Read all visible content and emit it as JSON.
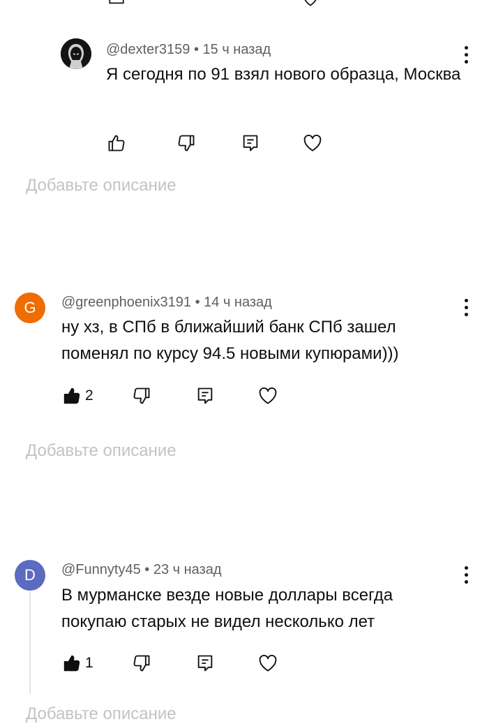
{
  "comments": [
    {
      "author": "@dexter3159",
      "time": "15 ч назад",
      "text": "Я сегодня по 91 взял нового образца, Москва",
      "likes": "",
      "liked": false,
      "avatar_letter": "",
      "avatar_color": "#1b1b1b"
    },
    {
      "author": "@greenphoenix3191",
      "time": "14 ч назад",
      "text": "ну хз, в СПб в ближайший банк СПб зашел поменял по курсу 94.5 новыми купюрами)))",
      "likes": "2",
      "liked": true,
      "avatar_letter": "G",
      "avatar_color": "#ef6c00"
    },
    {
      "author": "@Funnyty45",
      "time": "23 ч назад",
      "text": "В мурманске везде новые доллары всегда покупаю старых не видел несколько лет",
      "likes": "1",
      "liked": true,
      "avatar_letter": "D",
      "avatar_color": "#5c6bc0"
    }
  ],
  "separator": "•",
  "add_description_placeholder": "Добавьте описание",
  "colors": {
    "meta_text": "#606060",
    "placeholder": "#c3c3c3",
    "icon": "#0f0f0f"
  },
  "icons": [
    "like-icon",
    "dislike-icon",
    "reply-icon",
    "heart-icon",
    "more-vert-icon"
  ]
}
